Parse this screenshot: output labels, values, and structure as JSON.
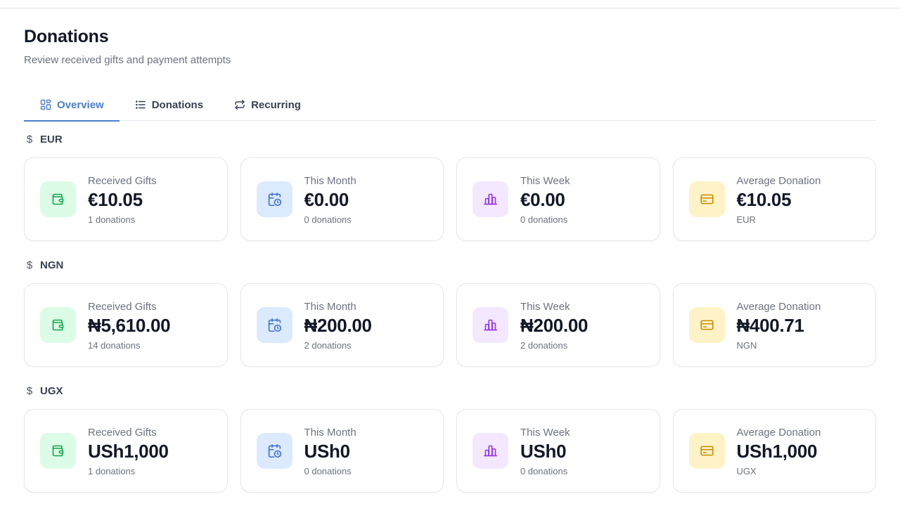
{
  "header": {
    "title": "Donations",
    "subtitle": "Review received gifts and payment attempts"
  },
  "tabs": [
    {
      "label": "Overview",
      "icon": "grid-icon",
      "active": true
    },
    {
      "label": "Donations",
      "icon": "list-icon",
      "active": false
    },
    {
      "label": "Recurring",
      "icon": "repeat-icon",
      "active": false
    }
  ],
  "colors": {
    "accent": "#4a7fcb",
    "green": "#16a34a",
    "blue": "#3b6fd0",
    "purple": "#9333ea",
    "yellow": "#ca8a04"
  },
  "sections": [
    {
      "currency_symbol": "$",
      "currency": "EUR",
      "cards": [
        {
          "label": "Received Gifts",
          "value": "€10.05",
          "sub": "1 donations",
          "icon": "wallet-icon",
          "tone": "green"
        },
        {
          "label": "This Month",
          "value": "€0.00",
          "sub": "0 donations",
          "icon": "calendar-clock-icon",
          "tone": "blue"
        },
        {
          "label": "This Week",
          "value": "€0.00",
          "sub": "0 donations",
          "icon": "bar-chart-icon",
          "tone": "purple"
        },
        {
          "label": "Average Donation",
          "value": "€10.05",
          "sub": "EUR",
          "icon": "credit-card-icon",
          "tone": "yellow"
        }
      ]
    },
    {
      "currency_symbol": "$",
      "currency": "NGN",
      "cards": [
        {
          "label": "Received Gifts",
          "value": "₦5,610.00",
          "sub": "14 donations",
          "icon": "wallet-icon",
          "tone": "green"
        },
        {
          "label": "This Month",
          "value": "₦200.00",
          "sub": "2 donations",
          "icon": "calendar-clock-icon",
          "tone": "blue"
        },
        {
          "label": "This Week",
          "value": "₦200.00",
          "sub": "2 donations",
          "icon": "bar-chart-icon",
          "tone": "purple"
        },
        {
          "label": "Average Donation",
          "value": "₦400.71",
          "sub": "NGN",
          "icon": "credit-card-icon",
          "tone": "yellow"
        }
      ]
    },
    {
      "currency_symbol": "$",
      "currency": "UGX",
      "cards": [
        {
          "label": "Received Gifts",
          "value": "USh1,000",
          "sub": "1 donations",
          "icon": "wallet-icon",
          "tone": "green"
        },
        {
          "label": "This Month",
          "value": "USh0",
          "sub": "0 donations",
          "icon": "calendar-clock-icon",
          "tone": "blue"
        },
        {
          "label": "This Week",
          "value": "USh0",
          "sub": "0 donations",
          "icon": "bar-chart-icon",
          "tone": "purple"
        },
        {
          "label": "Average Donation",
          "value": "USh1,000",
          "sub": "UGX",
          "icon": "credit-card-icon",
          "tone": "yellow"
        }
      ]
    }
  ]
}
